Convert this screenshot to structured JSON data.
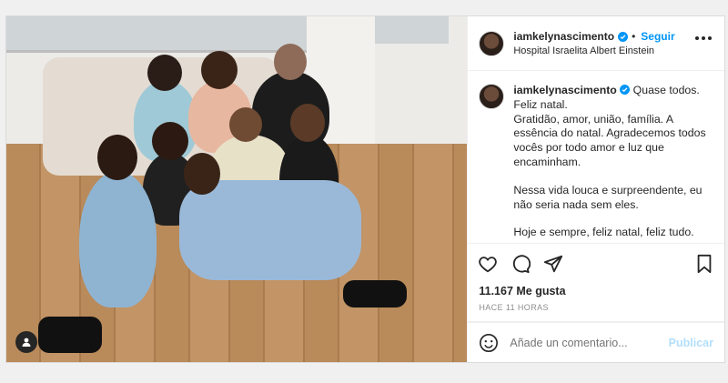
{
  "post": {
    "username": "iamkelynascimento",
    "follow_label": "Seguir",
    "dot": "•",
    "location": "Hospital Israelita Albert Einstein",
    "caption": {
      "first_line": "Quase todos.",
      "lines": [
        "Feliz natal.",
        "Gratidão, amor, união, família. A essência do natal. Agradecemos todos vocês por todo amor e luz que encaminham."
      ],
      "paragraph2": "Nessa vida louca e surpreendente, eu não seria nada sem eles.",
      "paragraph3": "Hoje e sempre, feliz natal, feliz tudo."
    },
    "likes": "11.167 Me gusta",
    "time": "HACE 11 HORAS",
    "comment_placeholder": "Añade un comentario...",
    "publish_label": "Publicar"
  },
  "icons": {
    "verified": "verified-badge-icon",
    "more": "more-options-icon",
    "like": "heart-icon",
    "comment": "comment-icon",
    "share": "share-icon",
    "save": "bookmark-icon",
    "emoji": "emoji-icon",
    "tag": "user-tag-icon"
  },
  "colors": {
    "accent": "#0095f6",
    "publish_disabled": "#b2dffc",
    "verified": "#0095f6"
  }
}
